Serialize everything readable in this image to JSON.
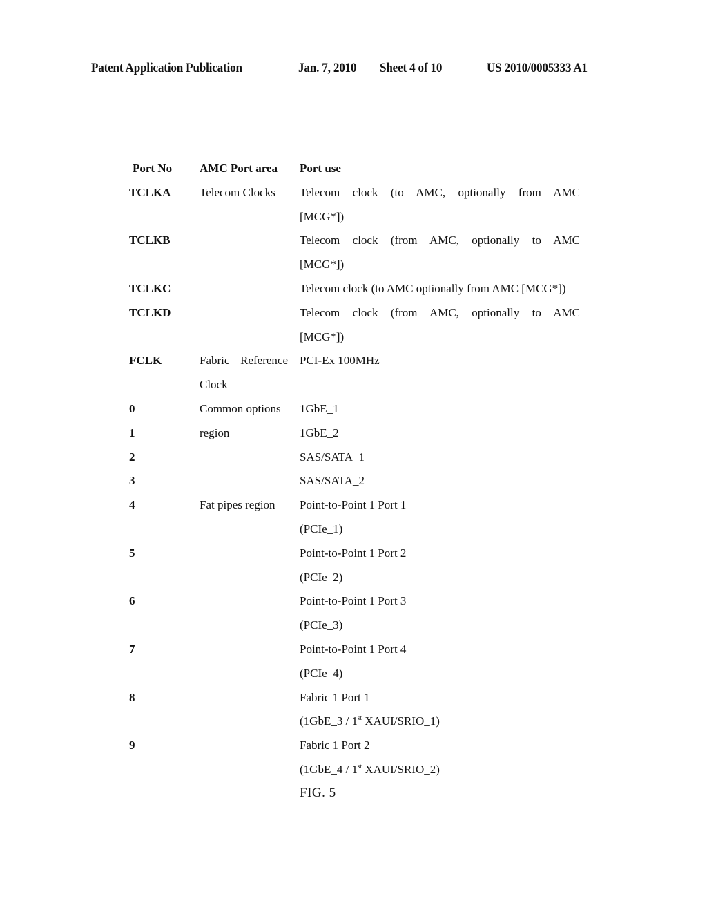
{
  "header": {
    "publication": "Patent Application Publication",
    "date": "Jan. 7, 2010",
    "sheet": "Sheet 4 of 10",
    "number": "US 2010/0005333 A1"
  },
  "table": {
    "columns": [
      "Port No",
      "AMC Port area",
      "Port use"
    ],
    "rows": [
      {
        "port": "TCLKA",
        "area": [
          "Telecom Clocks",
          ""
        ],
        "use": [
          "Telecom clock (to AMC, optionally from AMC",
          "[MCG*])"
        ]
      },
      {
        "port": "TCLKB",
        "area": [
          "",
          ""
        ],
        "use": [
          "Telecom clock (from AMC, optionally to AMC",
          "[MCG*])"
        ]
      },
      {
        "port": "TCLKC",
        "area": [
          ""
        ],
        "use": [
          "Telecom clock (to AMC optionally from AMC [MCG*])"
        ]
      },
      {
        "port": "TCLKD",
        "area": [
          "",
          ""
        ],
        "use": [
          "Telecom clock (from AMC, optionally to AMC",
          "[MCG*])"
        ]
      },
      {
        "port": "FCLK",
        "area": [
          "Fabric Reference",
          "Clock"
        ],
        "use": [
          "PCI-Ex 100MHz",
          ""
        ]
      },
      {
        "port": "0",
        "area": [
          "Common options"
        ],
        "use": [
          "1GbE_1"
        ]
      },
      {
        "port": "1",
        "area": [
          "region"
        ],
        "use": [
          "1GbE_2"
        ]
      },
      {
        "port": "2",
        "area": [
          ""
        ],
        "use": [
          "SAS/SATA_1"
        ]
      },
      {
        "port": "3",
        "area": [
          ""
        ],
        "use": [
          "SAS/SATA_2"
        ]
      },
      {
        "port": "4",
        "area": [
          "Fat pipes region",
          ""
        ],
        "use": [
          "Point-to-Point 1 Port 1",
          "(PCIe_1)"
        ]
      },
      {
        "port": "5",
        "area": [
          "",
          ""
        ],
        "use": [
          "Point-to-Point 1 Port 2",
          "(PCIe_2)"
        ]
      },
      {
        "port": "6",
        "area": [
          "",
          ""
        ],
        "use": [
          "Point-to-Point 1 Port 3",
          "(PCIe_3)"
        ]
      },
      {
        "port": "7",
        "area": [
          "",
          ""
        ],
        "use": [
          "Point-to-Point 1 Port 4",
          "(PCIe_4)"
        ]
      },
      {
        "port": "8",
        "area": [
          "",
          ""
        ],
        "use": [
          "Fabric 1 Port 1",
          "(1GbE_3 / 1st XAUI/SRIO_1)"
        ]
      },
      {
        "port": "9",
        "area": [
          "",
          ""
        ],
        "use": [
          "Fabric 1 Port 2",
          "(1GbE_4 / 1st XAUI/SRIO_2)"
        ]
      }
    ]
  },
  "figure_label": "FIG. 5"
}
